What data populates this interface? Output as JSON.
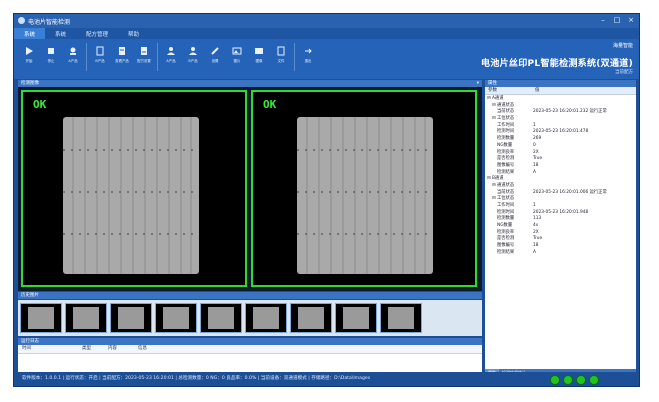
{
  "window": {
    "title": "电池片智能检测"
  },
  "tabs": [
    {
      "label": "系统"
    },
    {
      "label": "系统"
    },
    {
      "label": "配方管理"
    },
    {
      "label": "帮助"
    }
  ],
  "toolbar": {
    "items": [
      {
        "label": "开始",
        "icon": "play-icon"
      },
      {
        "label": "停止",
        "icon": "stop-icon"
      },
      {
        "label": "A产品",
        "icon": "tag-icon"
      },
      {
        "label": "B产品",
        "icon": "edit-icon"
      },
      {
        "label": "查看产品",
        "icon": "doc-icon"
      },
      {
        "label": "配方设置",
        "icon": "doc-icon"
      },
      {
        "label": "A产品",
        "icon": "user-icon"
      },
      {
        "label": "B产品",
        "icon": "user-icon"
      },
      {
        "label": "设置",
        "icon": "tools-icon"
      },
      {
        "label": "图片",
        "icon": "image-icon"
      },
      {
        "label": "图像",
        "icon": "image-icon"
      },
      {
        "label": "文件",
        "icon": "file-icon"
      },
      {
        "label": "退出",
        "icon": "exit-icon"
      }
    ]
  },
  "brand": {
    "text": "海量智能"
  },
  "system": {
    "title": "电池片丝印PL智能检测系统(双通道)",
    "subtitle": "当前配方"
  },
  "main": {
    "camera_header": "检测图像",
    "cameras": [
      {
        "result": "OK"
      },
      {
        "result": "OK"
      }
    ],
    "thumbs_header": "历史图片",
    "thumb_count": 9,
    "log_header": "运行日志",
    "log_columns": [
      "时间",
      "类型",
      "内容",
      "信息"
    ]
  },
  "right": {
    "header": "属性",
    "columns": [
      "参数",
      "值"
    ],
    "tree": [
      {
        "indent": 0,
        "key": "A通道",
        "value": ""
      },
      {
        "indent": 1,
        "key": "通道状态",
        "value": ""
      },
      {
        "indent": 2,
        "key": "当前状态",
        "value": "2023-05-23 16:20:01.232 运行正常"
      },
      {
        "indent": 1,
        "key": "工位状态",
        "value": ""
      },
      {
        "indent": 2,
        "key": "工作时间",
        "value": "1"
      },
      {
        "indent": 2,
        "key": "检测时间",
        "value": "2023-05-23 16:20:01.478"
      },
      {
        "indent": 2,
        "key": "检测数量",
        "value": "269"
      },
      {
        "indent": 2,
        "key": "NG数量",
        "value": "0"
      },
      {
        "indent": 2,
        "key": "检测良率",
        "value": "2X"
      },
      {
        "indent": 2,
        "key": "是否检测",
        "value": "True"
      },
      {
        "indent": 2,
        "key": "图像编号",
        "value": "18"
      },
      {
        "indent": 2,
        "key": "检测结果",
        "value": "A"
      },
      {
        "indent": 0,
        "key": "B通道",
        "value": ""
      },
      {
        "indent": 1,
        "key": "通道状态",
        "value": ""
      },
      {
        "indent": 2,
        "key": "当前状态",
        "value": "2023-05-23 16:20:01.006 运行正常"
      },
      {
        "indent": 1,
        "key": "工位状态",
        "value": ""
      },
      {
        "indent": 2,
        "key": "工作时间",
        "value": "1"
      },
      {
        "indent": 2,
        "key": "检测时间",
        "value": "2023-05-23 16:20:01.948"
      },
      {
        "indent": 2,
        "key": "检测数量",
        "value": "113"
      },
      {
        "indent": 2,
        "key": "NG数量",
        "value": "4x"
      },
      {
        "indent": 2,
        "key": "检测良率",
        "value": "2X"
      },
      {
        "indent": 2,
        "key": "是否检测",
        "value": "True"
      },
      {
        "indent": 2,
        "key": "图像编号",
        "value": "18"
      },
      {
        "indent": 2,
        "key": "检测结果",
        "value": "A"
      }
    ],
    "tabs": [
      "属性",
      "检测结果统计"
    ]
  },
  "status": {
    "text": "软件版本：1.0.0.1 | 运行状态：开启 | 当前配方：2023-05-23 16:20:01 | 总检测数量：0 NG：0 良品率：0.0% | 当前设备：双通道模式 | 存储路径：D:\\Data\\Images"
  }
}
